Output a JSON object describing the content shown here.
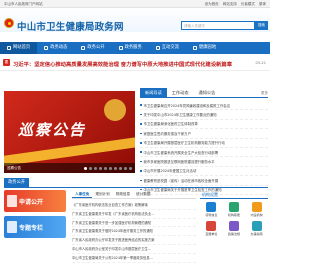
{
  "topbar": {
    "left_text": "中山市人民政府门户网站",
    "links": [
      "设为首页",
      "网站支持",
      "长者模式",
      "繁体"
    ]
  },
  "header": {
    "site_title": "中山市卫生健康局政务网",
    "search_placeholder": "请输入关键字",
    "search_button": "搜索"
  },
  "nav": {
    "items": [
      "网站首页",
      "政务动态",
      "政务公开",
      "政务服务",
      "互动交流",
      "健康园地"
    ]
  },
  "headline": {
    "label": "要",
    "text": "习近平：坚定信心推动高质量发展高效能治理 奋力谱写中原大地推进中国式现代化建设新篇章",
    "date": "05-21"
  },
  "sidebar": {
    "tab_label": "新闻中心"
  },
  "banner": {
    "big_text": "巡察公告",
    "caption": "巡察公告",
    "dots": 10,
    "active_dot": 0
  },
  "news": {
    "tabs": [
      "新闻导读",
      "工作动态",
      "通知公告"
    ],
    "more": "更多",
    "items": [
      "市卫生健康局召开2024年党风廉政建设和反腐败工作会议",
      "关于印发中山市2024年卫生健康工作要点的通知",
      "市卫生健康局深化医药卫生体制改革",
      "家庭医生签约服务惠及千家万户",
      "市卫生健康局开展基层医疗卫生机构服务能力提升行动",
      "中山市卫生健康系统开展安全生产大检查行动部署",
      "我市多家医院推进互联网医院建设提升服务水平",
      "中山市开展2024年爱国卫生月活动",
      "健康教育进校园（宣传）活动在我市各校全面开展",
      "中山市卫生健康局关于开展夏季卫生检查工作的通知"
    ]
  },
  "section": {
    "title": "政务公开"
  },
  "promos": [
    {
      "label": "申请公开",
      "color": "red"
    },
    {
      "label": "专题专栏",
      "color": "blue"
    }
  ],
  "gov_open": {
    "tabs": [
      "人事任免",
      "规划计划",
      "财政信息",
      "统计数据"
    ],
    "items": [
      "《广东省医疗机构依法执业自查工作方案》政策解读",
      "广东省卫生健康委关于印发《广东省医疗机构依法执业...",
      "广东省卫生健康委关于进一步加强医疗机构管理的通知",
      "广东省卫生健康委关于做好2024年医疗服务工作的通知",
      "广东省人民政府办公厅印发关于推进医养结合的实施方案",
      "中山市人民政府办公室关于印发中山市基层医疗卫生...",
      "中山市卫生健康局关于公布2024年第一季度政务信息..."
    ]
  },
  "services": {
    "title": "机构设置",
    "items": [
      "领导信息",
      "机构职能",
      "内设机构",
      "直属单位",
      "政策法规",
      "办事指南"
    ]
  },
  "colors": {
    "brand_blue": "#1a6fc2",
    "headline_red": "#c22020",
    "banner_red": "#d12a1c"
  }
}
